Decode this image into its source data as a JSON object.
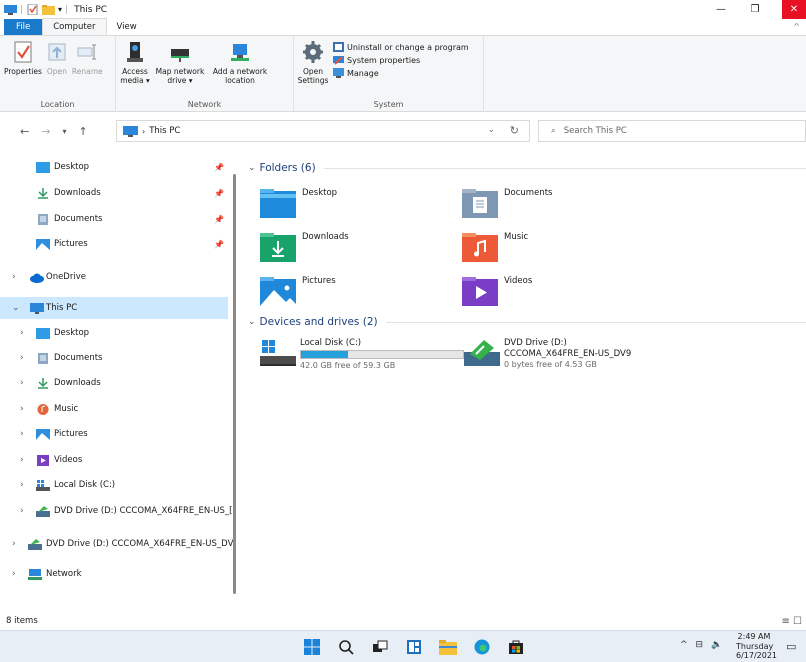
{
  "window": {
    "title": "This PC",
    "minimize": "—",
    "maximize": "❐",
    "close": "✕"
  },
  "tabs": [
    {
      "label": "File"
    },
    {
      "label": "Computer"
    },
    {
      "label": "View"
    }
  ],
  "ribbon": {
    "location": {
      "label": "Location",
      "properties": "Properties",
      "open": "Open",
      "rename": "Rename"
    },
    "network": {
      "label": "Network",
      "access_media": "Access media ▾",
      "map_network_drive": "Map network drive ▾",
      "add_network_location": "Add a network location"
    },
    "system": {
      "label": "System",
      "open_settings": "Open Settings",
      "uninstall": "Uninstall or change a program",
      "system_properties": "System properties",
      "manage": "Manage"
    }
  },
  "address": {
    "path": "This PC",
    "search_placeholder": "Search This PC"
  },
  "navigation": {
    "quick_access": [
      {
        "label": "Desktop"
      },
      {
        "label": "Downloads"
      },
      {
        "label": "Documents"
      },
      {
        "label": "Pictures"
      }
    ],
    "onedrive": "OneDrive",
    "this_pc": "This PC",
    "this_pc_children": [
      {
        "label": "Desktop"
      },
      {
        "label": "Documents"
      },
      {
        "label": "Downloads"
      },
      {
        "label": "Music"
      },
      {
        "label": "Pictures"
      },
      {
        "label": "Videos"
      },
      {
        "label": "Local Disk (C:)"
      },
      {
        "label": "DVD Drive (D:) CCCOMA_X64FRE_EN-US_[]"
      }
    ],
    "dvd_root": "DVD Drive (D:) CCCOMA_X64FRE_EN-US_DV",
    "network": "Network"
  },
  "content": {
    "folders_header": "Folders (6)",
    "folders": [
      {
        "label": "Desktop"
      },
      {
        "label": "Documents"
      },
      {
        "label": "Downloads"
      },
      {
        "label": "Music"
      },
      {
        "label": "Pictures"
      },
      {
        "label": "Videos"
      }
    ],
    "drives_header": "Devices and drives (2)",
    "drives": [
      {
        "name": "Local Disk (C:)",
        "free": "42.0 GB free of 59.3 GB",
        "used_fraction": 0.29
      },
      {
        "name": "DVD Drive (D:)",
        "volume": "CCCOMA_X64FRE_EN-US_DV9",
        "free": "0 bytes free of 4.53 GB"
      }
    ]
  },
  "status": {
    "items": "8 items"
  },
  "taskbar": {
    "time": "2:49 AM",
    "day": "Thursday",
    "date": "6/17/2021"
  },
  "colors": {
    "accent": "#1979ca",
    "selection": "#cce8ff",
    "progress": "#26a0da",
    "close": "#e81123"
  }
}
